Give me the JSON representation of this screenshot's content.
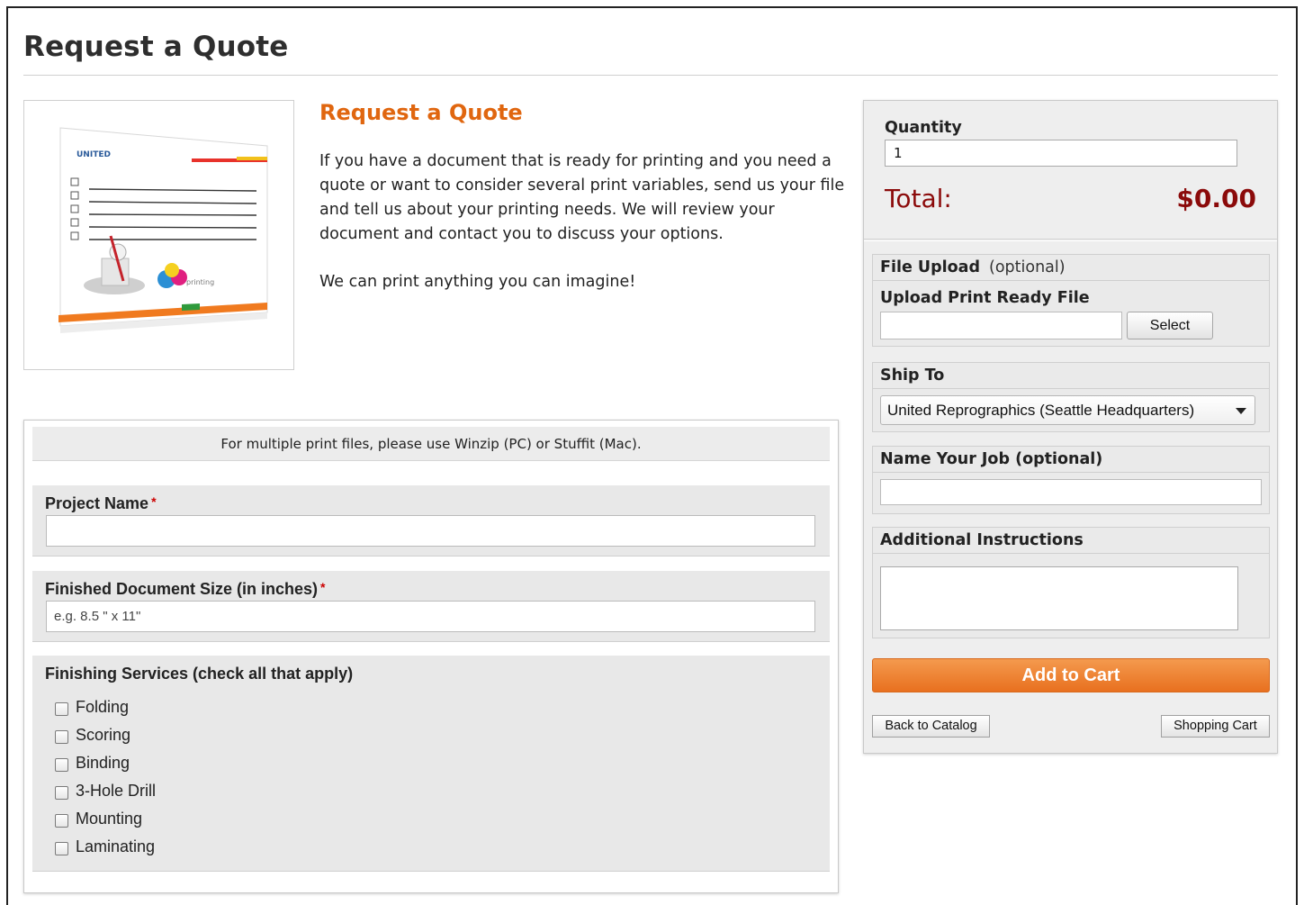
{
  "page": {
    "title": "Request a Quote"
  },
  "intro": {
    "heading": "Request a Quote",
    "paragraph1": "If you have a document that is ready for printing and you need a quote or want to consider several print variables, send us your file and tell us about your printing needs. We will review your document and contact you to discuss your options.",
    "paragraph2": "We can print anything you can imagine!"
  },
  "form": {
    "note": "For multiple print files, please use Winzip (PC) or Stuffit (Mac).",
    "project_name": {
      "label": "Project Name",
      "required_mark": "*",
      "value": ""
    },
    "doc_size": {
      "label": "Finished Document Size (in inches)",
      "required_mark": "*",
      "placeholder": "e.g. 8.5 \" x 11\""
    },
    "finishing": {
      "label": "Finishing Services (check all that apply)",
      "options": [
        {
          "label": "Folding",
          "checked": false
        },
        {
          "label": "Scoring",
          "checked": false
        },
        {
          "label": "Binding",
          "checked": false
        },
        {
          "label": "3-Hole Drill",
          "checked": false
        },
        {
          "label": "Mounting",
          "checked": false
        },
        {
          "label": "Laminating",
          "checked": false
        }
      ]
    }
  },
  "sidebar": {
    "quantity_label": "Quantity",
    "quantity_value": "1",
    "total_label": "Total:",
    "total_value": "$0.00",
    "file_upload": {
      "heading": "File Upload",
      "optional": "(optional)",
      "sublabel": "Upload Print Ready File",
      "select_label": "Select"
    },
    "ship_to": {
      "heading": "Ship To",
      "selected": "United Reprographics (Seattle Headquarters)"
    },
    "job_name": {
      "heading": "Name Your Job (optional)",
      "value": ""
    },
    "instructions": {
      "heading": "Additional Instructions",
      "value": ""
    },
    "add_to_cart_label": "Add to Cart",
    "back_label": "Back to Catalog",
    "cart_label": "Shopping Cart"
  },
  "colors": {
    "accent_orange": "#e0660f",
    "total_red": "#8b0a0a",
    "button_orange": "#ee7d2d"
  }
}
